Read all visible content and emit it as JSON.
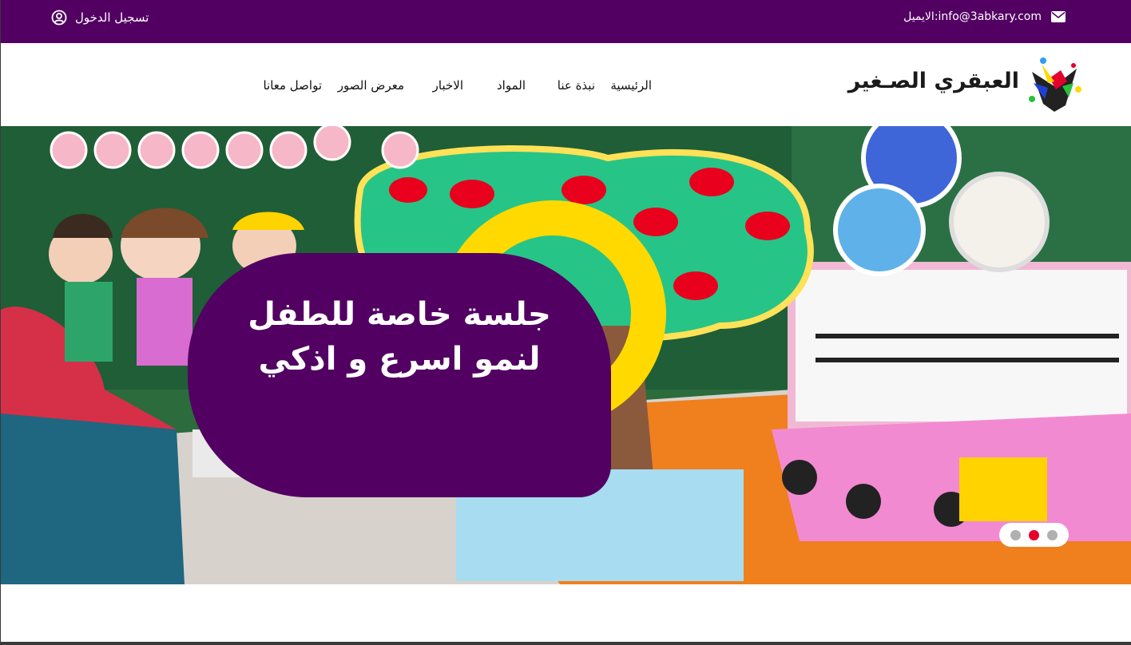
{
  "topbar": {
    "login_label": "تسجيل الدخول",
    "email_label": "الايميل:info@3abkary.com"
  },
  "logo": {
    "text": "العبقري الصـغير"
  },
  "nav": {
    "home": "الرئيسية",
    "about": "نبذة عنا",
    "subjects": "المواد",
    "news": "الاخبار",
    "gallery": "معرض الصور",
    "contact": "تواصل معانا"
  },
  "hero": {
    "title_line1": "جلسة خاصة للطفل",
    "title_line2": "لنمو اسرع و اذكي",
    "active_slide": 2,
    "slide_count": 3
  },
  "colors": {
    "brand_purple": "#520062",
    "accent_yellow": "#ffd900",
    "dot_active": "#e4002b"
  },
  "icons": [
    "user-circle-icon",
    "envelope-icon"
  ]
}
